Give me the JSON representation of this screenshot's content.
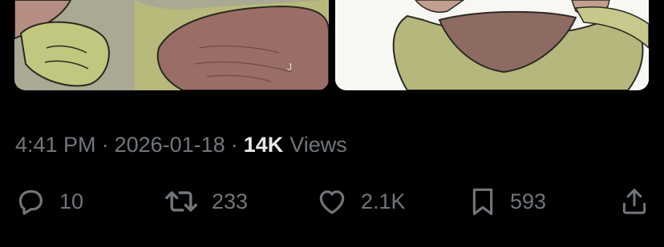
{
  "media": {
    "left_image": {
      "watermark": "J"
    },
    "right_image": {}
  },
  "tweet_meta": {
    "time": "4:41 PM",
    "separator": "·",
    "date": "2026-01-18",
    "views_count": "14K",
    "views_label": "Views"
  },
  "actions": {
    "reply": {
      "icon": "reply-icon",
      "count": "10"
    },
    "repost": {
      "icon": "repost-icon",
      "count": "233"
    },
    "like": {
      "icon": "heart-icon",
      "count": "2.1K"
    },
    "bookmark": {
      "icon": "bookmark-icon",
      "count": "593"
    },
    "share": {
      "icon": "share-icon"
    }
  },
  "colors": {
    "background": "#000000",
    "secondary_text": "#71767b",
    "primary_text": "#e7e9ea"
  }
}
